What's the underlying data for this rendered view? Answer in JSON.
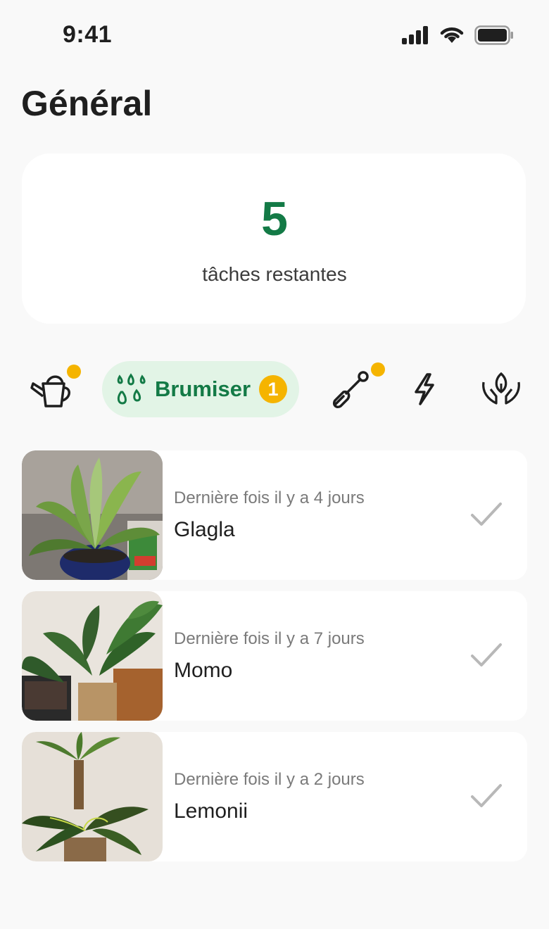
{
  "status_bar": {
    "time": "9:41"
  },
  "page": {
    "title": "Général"
  },
  "summary": {
    "count": "5",
    "label": "tâches restantes"
  },
  "tabs": [
    {
      "id": "watering",
      "icon": "watering-can-icon",
      "has_notification": true
    },
    {
      "id": "misting",
      "icon": "water-drops-icon",
      "label": "Brumiser",
      "badge": "1",
      "active": true
    },
    {
      "id": "repotting",
      "icon": "shovel-icon",
      "has_notification": true
    },
    {
      "id": "fertilizing",
      "icon": "lightning-icon",
      "has_notification": false
    },
    {
      "id": "care",
      "icon": "hands-plant-icon",
      "has_notification": false
    }
  ],
  "tasks": [
    {
      "subtitle": "Dernière fois il y a 4 jours",
      "name": "Glagla",
      "photo": "aglaonema-plant-photo"
    },
    {
      "subtitle": "Dernière fois il y a 7 jours",
      "name": "Momo",
      "photo": "monstera-plant-photo"
    },
    {
      "subtitle": "Dernière fois il y a 2 jours",
      "name": "Lemonii",
      "photo": "maranta-plant-photo"
    }
  ],
  "colors": {
    "accent_green": "#137a46",
    "notification_yellow": "#f5b400",
    "active_tab_bg": "#e2f4e6",
    "check_gray": "#b8b8b8"
  }
}
